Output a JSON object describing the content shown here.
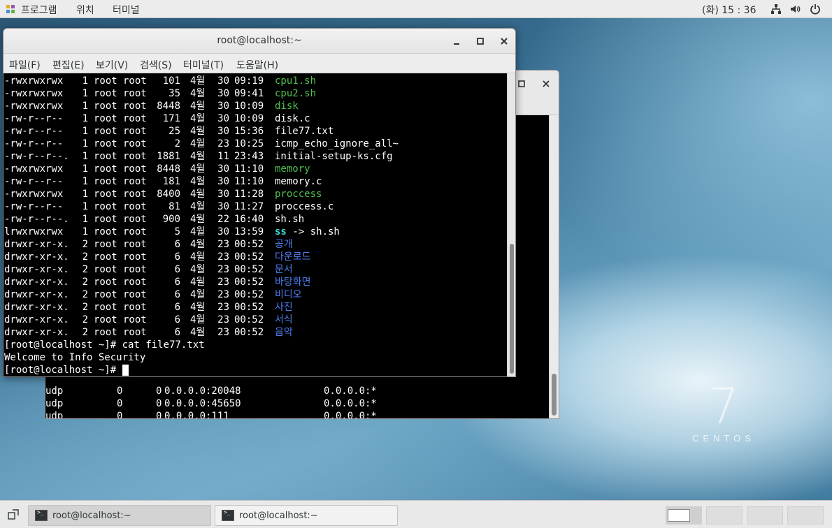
{
  "topbar": {
    "apps_label": "프로그램",
    "places_label": "위치",
    "app_label": "터미널",
    "clock": "(화) 15 : 36",
    "icons": [
      "network-icon",
      "volume-icon",
      "power-icon"
    ]
  },
  "desktop": {
    "logo_number": "7",
    "logo_text": "CENTOS"
  },
  "back_window": {
    "lines": [
      [
        "udp",
        "0",
        "0",
        "0.0.0.0:20048",
        "0.0.0.0:*"
      ],
      [
        "udp",
        "0",
        "0",
        "0.0.0.0:45650",
        "0.0.0.0:*"
      ],
      [
        "udp",
        "0",
        "0",
        "0.0.0.0:111",
        "0.0.0.0:*"
      ]
    ]
  },
  "window": {
    "title": "root@localhost:~",
    "menu": [
      "파일(F)",
      "편집(E)",
      "보기(V)",
      "검색(S)",
      "터미널(T)",
      "도움말(H)"
    ]
  },
  "terminal": {
    "files": [
      {
        "perm": "-rwxrwxrwx",
        "links": "1",
        "owner": "root",
        "group": "root",
        "size": "101",
        "month": "4월",
        "day": "30",
        "time": "09:19",
        "name": "cpu1.sh",
        "color": "green"
      },
      {
        "perm": "-rwxrwxrwx",
        "links": "1",
        "owner": "root",
        "group": "root",
        "size": "35",
        "month": "4월",
        "day": "30",
        "time": "09:41",
        "name": "cpu2.sh",
        "color": "green"
      },
      {
        "perm": "-rwxrwxrwx",
        "links": "1",
        "owner": "root",
        "group": "root",
        "size": "8448",
        "month": "4월",
        "day": "30",
        "time": "10:09",
        "name": "disk",
        "color": "green"
      },
      {
        "perm": "-rw-r--r--",
        "links": "1",
        "owner": "root",
        "group": "root",
        "size": "171",
        "month": "4월",
        "day": "30",
        "time": "10:09",
        "name": "disk.c",
        "color": "white"
      },
      {
        "perm": "-rw-r--r--",
        "links": "1",
        "owner": "root",
        "group": "root",
        "size": "25",
        "month": "4월",
        "day": "30",
        "time": "15:36",
        "name": "file77.txt",
        "color": "white"
      },
      {
        "perm": "-rw-r--r--",
        "links": "1",
        "owner": "root",
        "group": "root",
        "size": "2",
        "month": "4월",
        "day": "23",
        "time": "10:25",
        "name": "icmp_echo_ignore_all~",
        "color": "white"
      },
      {
        "perm": "-rw-r--r--.",
        "links": "1",
        "owner": "root",
        "group": "root",
        "size": "1881",
        "month": "4월",
        "day": "11",
        "time": "23:43",
        "name": "initial-setup-ks.cfg",
        "color": "white"
      },
      {
        "perm": "-rwxrwxrwx",
        "links": "1",
        "owner": "root",
        "group": "root",
        "size": "8448",
        "month": "4월",
        "day": "30",
        "time": "11:10",
        "name": "memory",
        "color": "green"
      },
      {
        "perm": "-rw-r--r--",
        "links": "1",
        "owner": "root",
        "group": "root",
        "size": "181",
        "month": "4월",
        "day": "30",
        "time": "11:10",
        "name": "memory.c",
        "color": "white"
      },
      {
        "perm": "-rwxrwxrwx",
        "links": "1",
        "owner": "root",
        "group": "root",
        "size": "8400",
        "month": "4월",
        "day": "30",
        "time": "11:28",
        "name": "proccess",
        "color": "green"
      },
      {
        "perm": "-rw-r--r--",
        "links": "1",
        "owner": "root",
        "group": "root",
        "size": "81",
        "month": "4월",
        "day": "30",
        "time": "11:27",
        "name": "proccess.c",
        "color": "white"
      },
      {
        "perm": "-rw-r--r--.",
        "links": "1",
        "owner": "root",
        "group": "root",
        "size": "900",
        "month": "4월",
        "day": "22",
        "time": "16:40",
        "name": "sh.sh",
        "color": "white"
      },
      {
        "perm": "lrwxrwxrwx",
        "links": "1",
        "owner": "root",
        "group": "root",
        "size": "5",
        "month": "4월",
        "day": "30",
        "time": "13:59",
        "name": "ss",
        "link_target": " -> sh.sh",
        "color": "cyan"
      },
      {
        "perm": "drwxr-xr-x.",
        "links": "2",
        "owner": "root",
        "group": "root",
        "size": "6",
        "month": "4월",
        "day": "23",
        "time": "00:52",
        "name": "공개",
        "color": "blue"
      },
      {
        "perm": "drwxr-xr-x.",
        "links": "2",
        "owner": "root",
        "group": "root",
        "size": "6",
        "month": "4월",
        "day": "23",
        "time": "00:52",
        "name": "다운로드",
        "color": "blue"
      },
      {
        "perm": "drwxr-xr-x.",
        "links": "2",
        "owner": "root",
        "group": "root",
        "size": "6",
        "month": "4월",
        "day": "23",
        "time": "00:52",
        "name": "문서",
        "color": "blue"
      },
      {
        "perm": "drwxr-xr-x.",
        "links": "2",
        "owner": "root",
        "group": "root",
        "size": "6",
        "month": "4월",
        "day": "23",
        "time": "00:52",
        "name": "바탕화면",
        "color": "blue"
      },
      {
        "perm": "drwxr-xr-x.",
        "links": "2",
        "owner": "root",
        "group": "root",
        "size": "6",
        "month": "4월",
        "day": "23",
        "time": "00:52",
        "name": "비디오",
        "color": "blue"
      },
      {
        "perm": "drwxr-xr-x.",
        "links": "2",
        "owner": "root",
        "group": "root",
        "size": "6",
        "month": "4월",
        "day": "23",
        "time": "00:52",
        "name": "사진",
        "color": "blue"
      },
      {
        "perm": "drwxr-xr-x.",
        "links": "2",
        "owner": "root",
        "group": "root",
        "size": "6",
        "month": "4월",
        "day": "23",
        "time": "00:52",
        "name": "서식",
        "color": "blue"
      },
      {
        "perm": "drwxr-xr-x.",
        "links": "2",
        "owner": "root",
        "group": "root",
        "size": "6",
        "month": "4월",
        "day": "23",
        "time": "00:52",
        "name": "음악",
        "color": "blue"
      }
    ],
    "tail": [
      "[root@localhost ~]# cat file77.txt",
      "Welcome to Info Security",
      "[root@localhost ~]# "
    ]
  },
  "taskbar": {
    "tasks": [
      "root@localhost:~",
      "root@localhost:~"
    ]
  },
  "colors": {
    "green": "#4ec04e",
    "blue": "#4d7cf0",
    "cyan": "#3fd7d7"
  }
}
